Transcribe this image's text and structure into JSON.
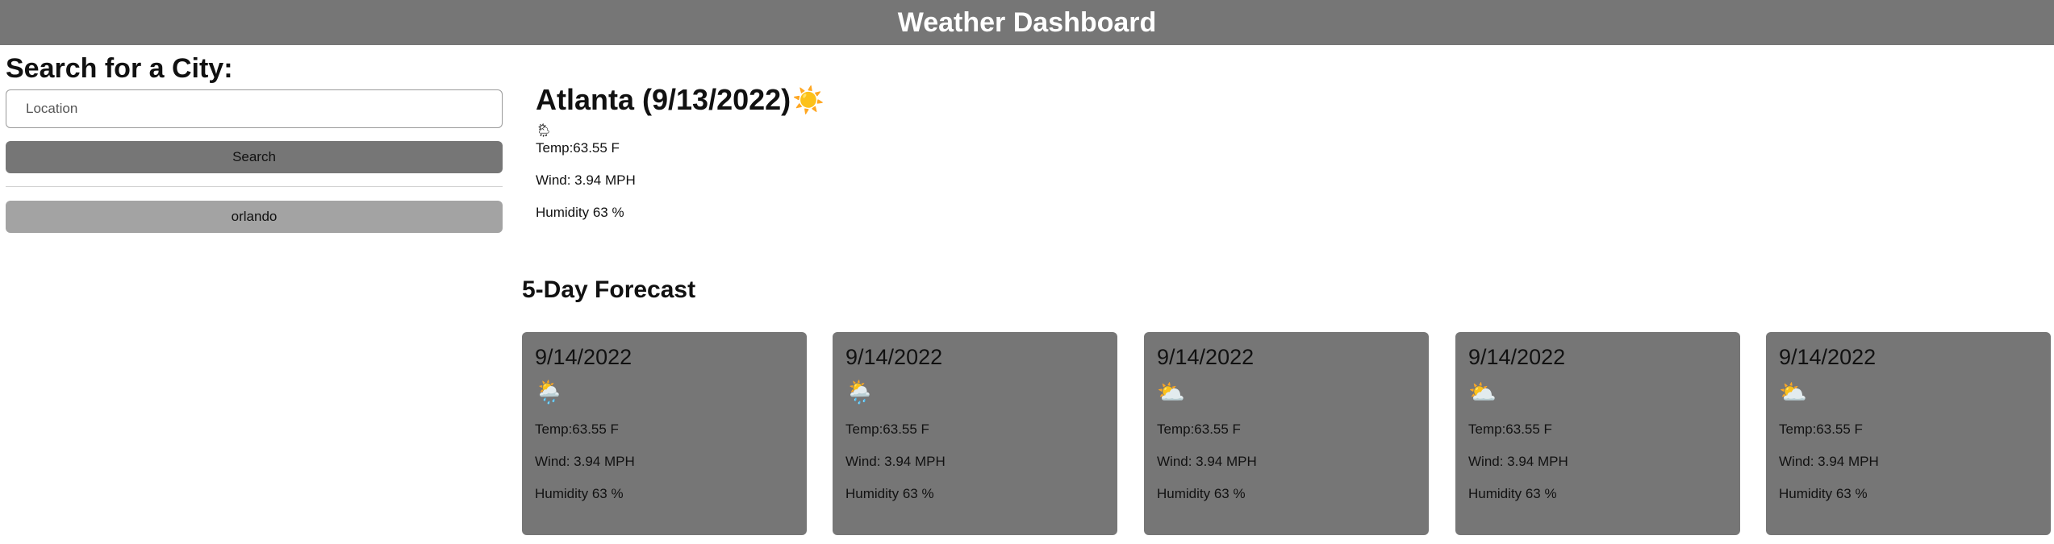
{
  "header": {
    "title": "Weather Dashboard"
  },
  "sidebar": {
    "heading": "Search for a City:",
    "location_placeholder": "Location",
    "location_value": "",
    "search_label": "Search",
    "history": [
      "orlando"
    ]
  },
  "current": {
    "title": "Atlanta (9/13/2022)",
    "title_icon": "☀️",
    "small_icon": "🌦",
    "temp": "Temp:63.55 F",
    "wind": "Wind: 3.94 MPH",
    "humidity": "Humidity 63 %"
  },
  "forecast": {
    "title": "5-Day Forecast",
    "days": [
      {
        "date": "9/14/2022",
        "icon": "🌦️",
        "temp": "Temp:63.55 F",
        "wind": "Wind: 3.94 MPH",
        "humidity": "Humidity 63 %"
      },
      {
        "date": "9/14/2022",
        "icon": "🌦️",
        "temp": "Temp:63.55 F",
        "wind": "Wind: 3.94 MPH",
        "humidity": "Humidity 63 %"
      },
      {
        "date": "9/14/2022",
        "icon": "⛅",
        "temp": "Temp:63.55 F",
        "wind": "Wind: 3.94 MPH",
        "humidity": "Humidity 63 %"
      },
      {
        "date": "9/14/2022",
        "icon": "⛅",
        "temp": "Temp:63.55 F",
        "wind": "Wind: 3.94 MPH",
        "humidity": "Humidity 63 %"
      },
      {
        "date": "9/14/2022",
        "icon": "⛅",
        "temp": "Temp:63.55 F",
        "wind": "Wind: 3.94 MPH",
        "humidity": "Humidity 63 %"
      }
    ]
  },
  "colors": {
    "header_bg": "#767676",
    "card_bg": "#767676",
    "history_bg": "#a3a3a3"
  }
}
